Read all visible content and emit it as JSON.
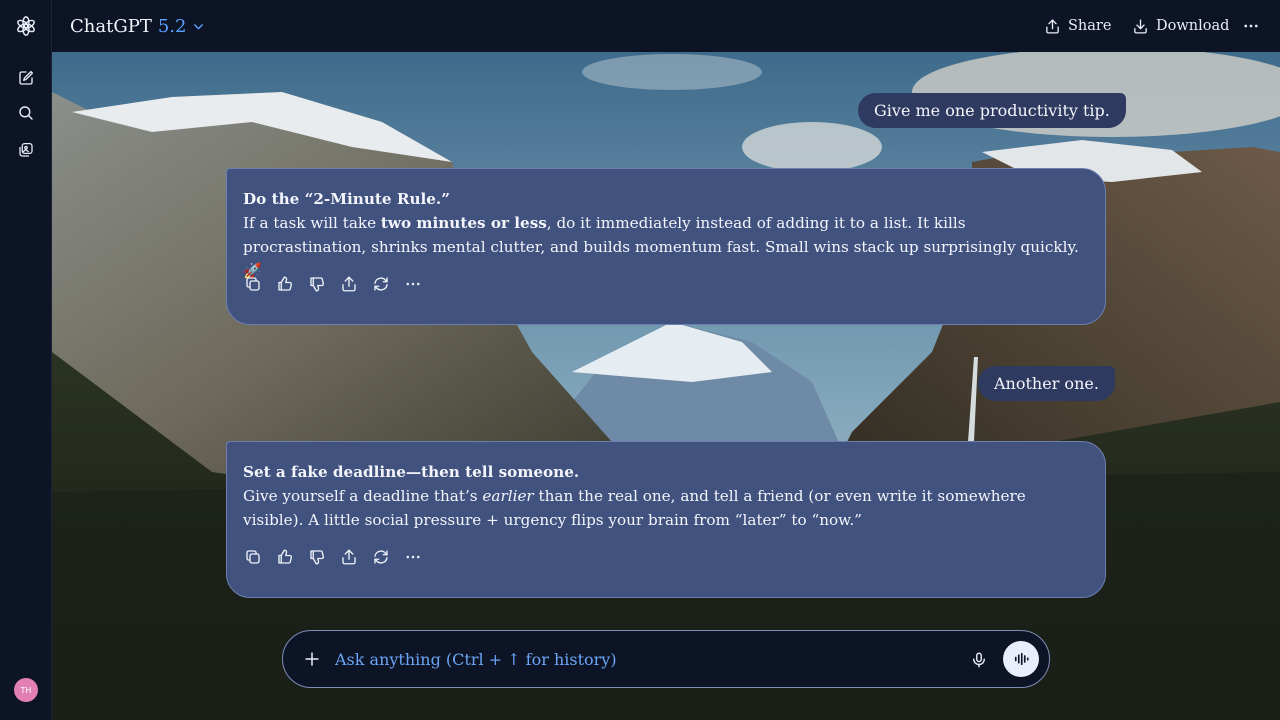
{
  "header": {
    "app_name": "ChatGPT",
    "model_version": "5.2",
    "share_label": "Share",
    "download_label": "Download"
  },
  "sidebar": {
    "avatar_initials": "TH"
  },
  "conversation": {
    "messages": [
      {
        "role": "user",
        "text": "Give me one productivity tip."
      },
      {
        "role": "assistant",
        "heading": "Do the “2-Minute Rule.”",
        "body_before": "If a task will take ",
        "body_bold": "two minutes or less",
        "body_after": ", do it immediately instead of adding it to a list. It kills procrastination, shrinks mental clutter, and builds momentum fast. Small wins stack up surprisingly quickly. 🚀"
      },
      {
        "role": "user",
        "text": "Another one."
      },
      {
        "role": "assistant",
        "heading": "Set a fake deadline—then tell someone.",
        "body_before": "Give yourself a deadline that’s ",
        "body_italic": "earlier",
        "body_after": " than the real one, and tell a friend (or even write it somewhere visible). A little social pressure + urgency flips your brain from “later” to “now.”"
      }
    ]
  },
  "composer": {
    "placeholder": "Ask anything (Ctrl + ↑ for history)"
  },
  "icons": {
    "logo": "openai-logo-icon",
    "new_chat": "edit-icon",
    "search": "search-icon",
    "library": "library-icon",
    "share": "share-icon",
    "download": "download-icon",
    "more": "more-icon",
    "copy": "copy-icon",
    "thumbs_up": "thumbs-up-icon",
    "thumbs_down": "thumbs-down-icon",
    "regenerate": "regenerate-icon",
    "plus": "plus-icon",
    "mic": "microphone-icon",
    "voice": "voice-mode-icon"
  },
  "colors": {
    "accent": "#5aa2ff",
    "user_bubble": "#2e3a5f",
    "assistant_bubble": "#41527f",
    "avatar": "#e27fb3"
  }
}
